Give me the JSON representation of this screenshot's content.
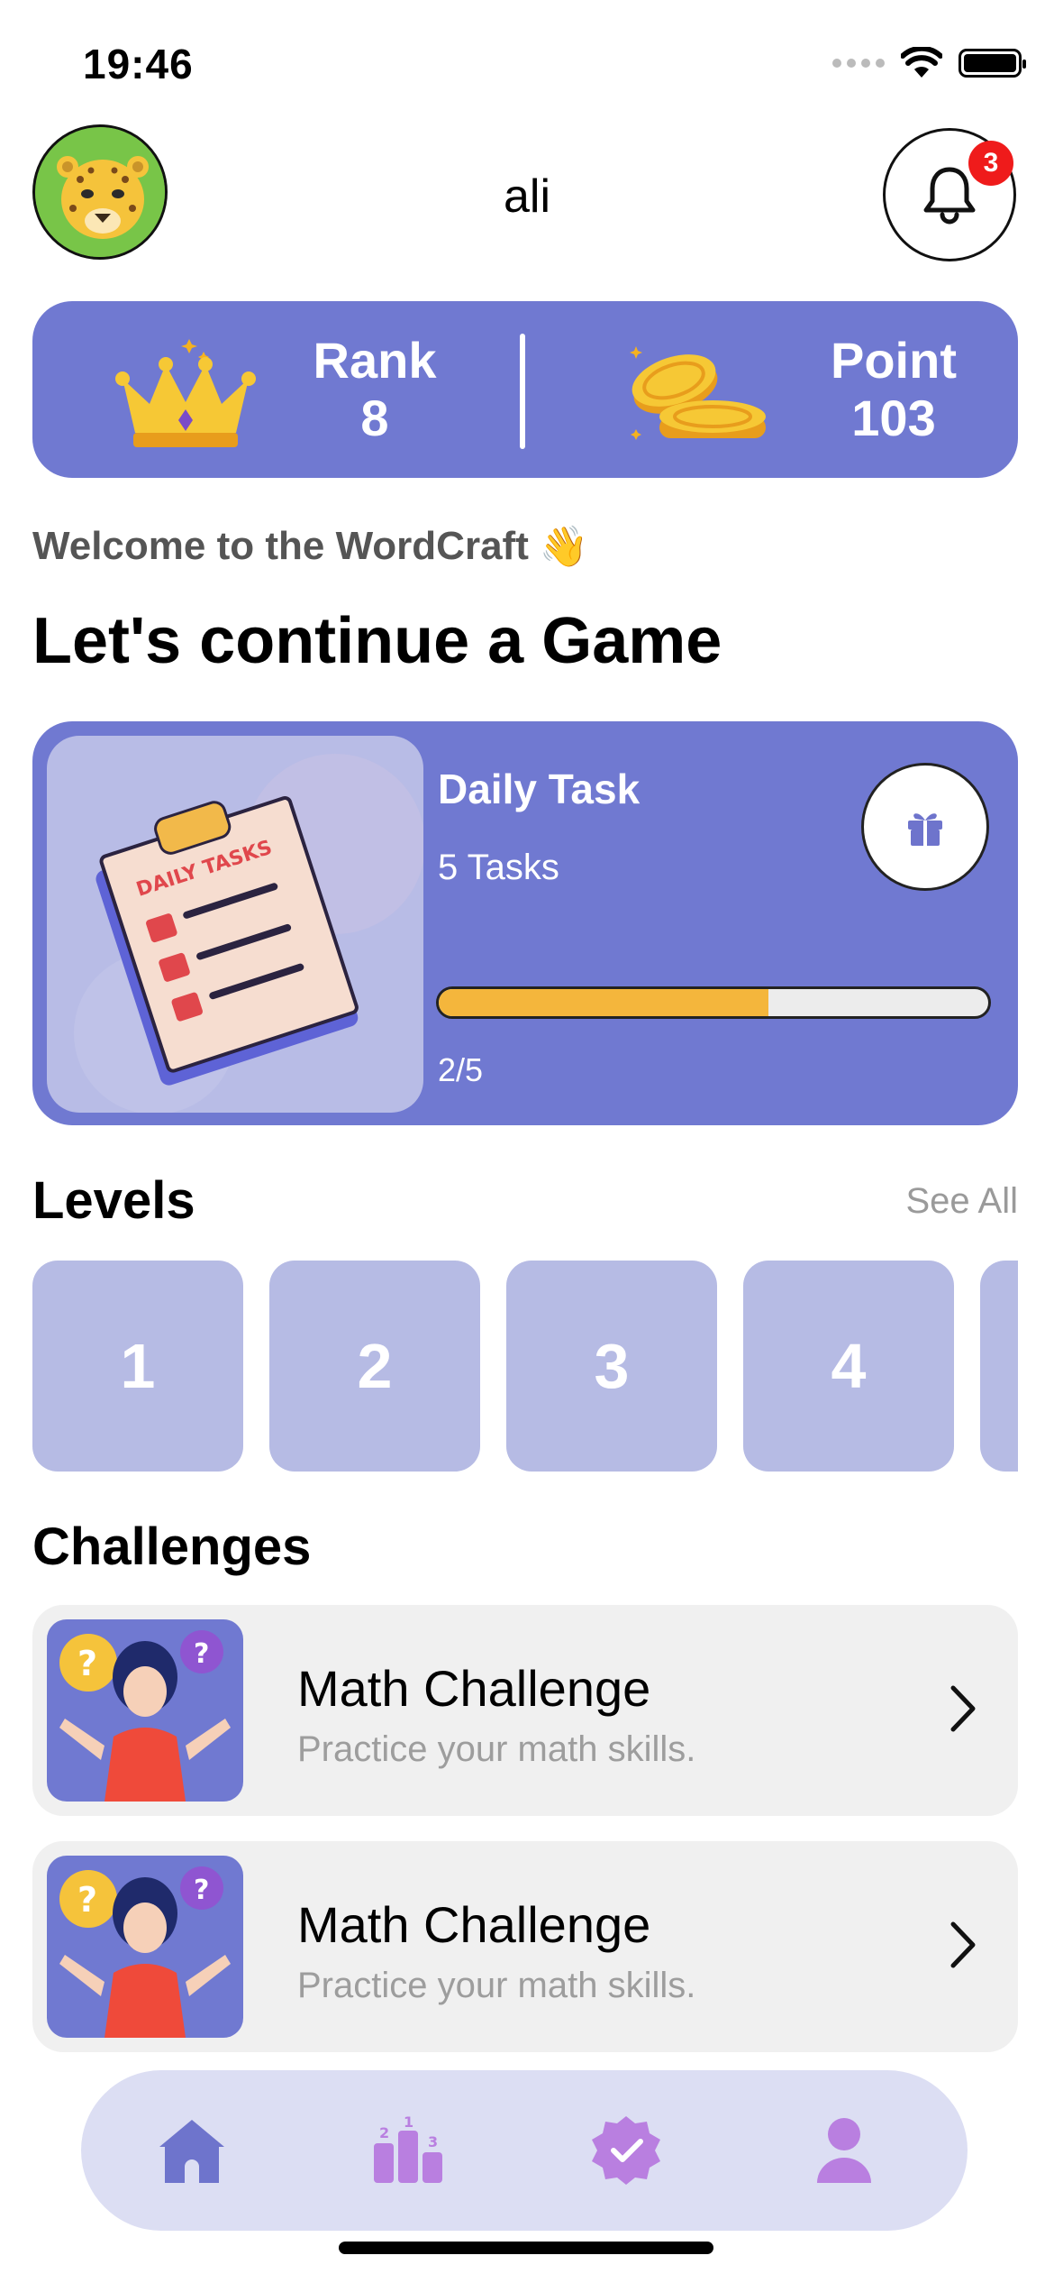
{
  "status_bar": {
    "time": "19:46"
  },
  "header": {
    "username": "ali",
    "notification_count": "3"
  },
  "stats": {
    "rank_label": "Rank",
    "rank_value": "8",
    "point_label": "Point",
    "point_value": "103"
  },
  "welcome": {
    "text": "Welcome to the WordCraft",
    "emoji": "👋"
  },
  "headline": "Let's continue a Game",
  "daily_task": {
    "title": "Daily Task",
    "subtitle": "5 Tasks",
    "progress_text": "2/5",
    "progress_fraction": 0.6,
    "image_text": "DAILY TASKS"
  },
  "levels": {
    "title": "Levels",
    "see_all": "See All",
    "items": [
      "1",
      "2",
      "3",
      "4"
    ]
  },
  "challenges": {
    "title": "Challenges",
    "items": [
      {
        "title": "Math Challenge",
        "subtitle": "Practice your math skills."
      },
      {
        "title": "Math Challenge",
        "subtitle": "Practice your math skills."
      }
    ]
  },
  "tabbar": {
    "items": [
      "home-icon",
      "leaderboard-icon",
      "verified-badge-icon",
      "profile-icon"
    ]
  },
  "colors": {
    "primary": "#7079D1",
    "progress": "#F4B63C",
    "badge": "#EF1B1B",
    "tab_active": "#6E74CC",
    "tab_inactive": "#B97FE0"
  }
}
